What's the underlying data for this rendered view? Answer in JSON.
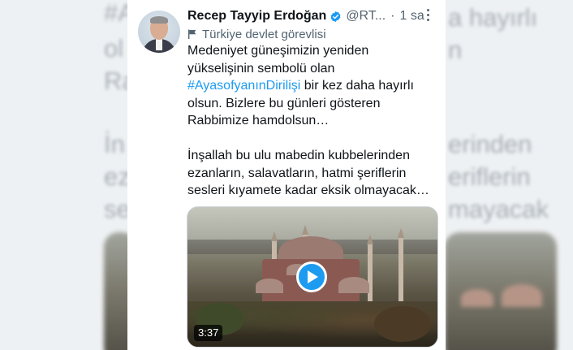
{
  "background": {
    "left_lines": [
      "#A",
      "ol",
      "Ra",
      "İn",
      "ez",
      "se"
    ],
    "right_lines": [
      "a hayırlı",
      "n",
      "",
      "erinden",
      "eriflerin",
      "mayacak"
    ]
  },
  "tweet": {
    "author_name": "Recep Tayyip Erdoğan",
    "handle": "@RT...",
    "separator": "·",
    "time": "1 sa",
    "label": "Türkiye devlet görevlisi",
    "text_line_1": "Medeniyet güneşimizin yeniden yükselişinin sembolü olan ",
    "hashtag": "#AyasofyanınDirilişi",
    "text_line_1_tail": " bir kez daha hayırlı olsun. Bizlere bu günleri gösteren Rabbimize hamdolsun…",
    "text_paragraph_2": "İnşallah bu ulu mabedin kubbelerinden ezanların, salavatların, hatmi şeriflerin sesleri kıyamete kadar eksik olmayacak…",
    "video_duration": "3:37"
  },
  "icons": {
    "verified": "verified-badge-icon",
    "label": "flag-icon",
    "more": "more-options-icon",
    "play": "play-icon"
  },
  "colors": {
    "accent": "#1d9bf0",
    "text": "#0f1419",
    "secondary_text": "#536471"
  }
}
